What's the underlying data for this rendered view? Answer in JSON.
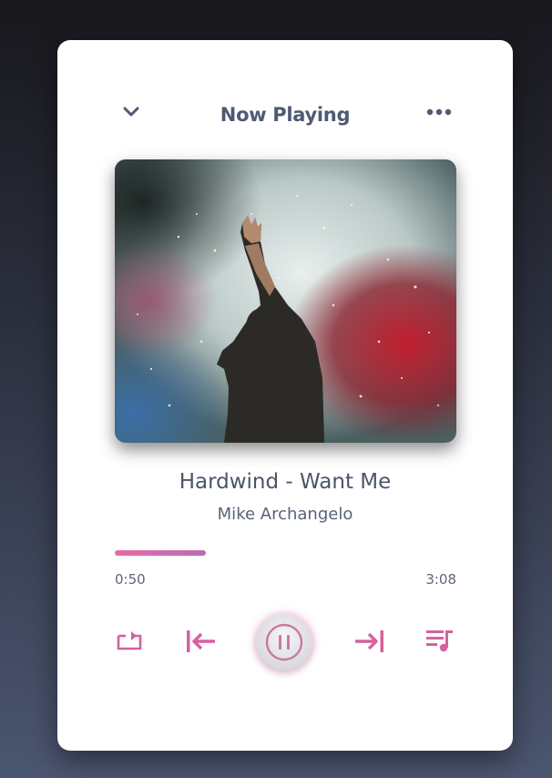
{
  "header": {
    "title": "Now Playing",
    "back_icon": "chevron-down-icon",
    "menu_icon": "more-horizontal-icon"
  },
  "track": {
    "title": "Hardwind - Want Me",
    "artist": "Mike Archangelo"
  },
  "progress": {
    "current": "0:50",
    "total": "3:08",
    "fraction": 0.266
  },
  "controls": {
    "repeat_icon": "repeat-icon",
    "previous_icon": "skip-previous-icon",
    "play_pause_icon": "pause-icon",
    "next_icon": "skip-next-icon",
    "queue_icon": "playlist-icon"
  },
  "colors": {
    "accent": "#d6619e",
    "text": "#4f5a73"
  }
}
